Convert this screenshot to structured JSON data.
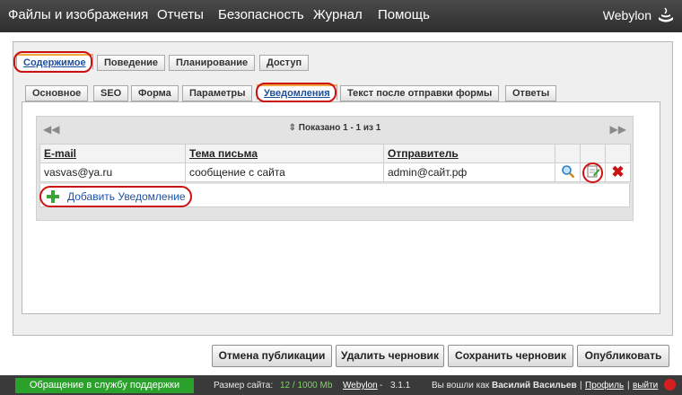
{
  "topnav": {
    "items": [
      "Файлы и изображения",
      "Отчеты",
      "Безопасность",
      "Журнал",
      "Помощь"
    ],
    "logo": "Webylon"
  },
  "tabs_main": [
    {
      "label": "Содержимое",
      "active": true
    },
    {
      "label": "Поведение",
      "active": false
    },
    {
      "label": "Планирование",
      "active": false
    },
    {
      "label": "Доступ",
      "active": false
    }
  ],
  "tabs_sub": [
    {
      "label": "Основное",
      "active": false
    },
    {
      "label": "SEO",
      "active": false
    },
    {
      "label": "Форма",
      "active": false
    },
    {
      "label": "Параметры",
      "active": false
    },
    {
      "label": "Уведомления",
      "active": true
    },
    {
      "label": "Текст после отправки формы",
      "active": false
    },
    {
      "label": "Ответы",
      "active": false
    }
  ],
  "pager": {
    "text": "Показано 1 - 1 из 1"
  },
  "table": {
    "columns": [
      "E-mail",
      "Тема письма",
      "Отправитель"
    ],
    "rows": [
      {
        "email": "vasvas@ya.ru",
        "subject": "сообщение с сайта",
        "sender": "admin@сайт.рф"
      }
    ],
    "add_label": "Добавить Уведомление"
  },
  "buttons": {
    "unpublish": "Отмена публикации",
    "delete_draft": "Удалить черновик",
    "save_draft": "Сохранить черновик",
    "publish": "Опубликовать"
  },
  "statusbar": {
    "support": "Обращение в службу поддержки",
    "size_label": "Размер сайта:",
    "size_value": "12 / 1000 Mb",
    "product": "Webylon",
    "version": "3.1.1",
    "logged_in_as": "Вы вошли как",
    "user": "Василий Васильев",
    "profile": "Профиль",
    "logout": "выйти"
  },
  "colors": {
    "accent": "#1a52a8",
    "highlight_ring": "#cc1111",
    "support_green": "#29a12b",
    "tab_active_top": "#f4a640"
  }
}
